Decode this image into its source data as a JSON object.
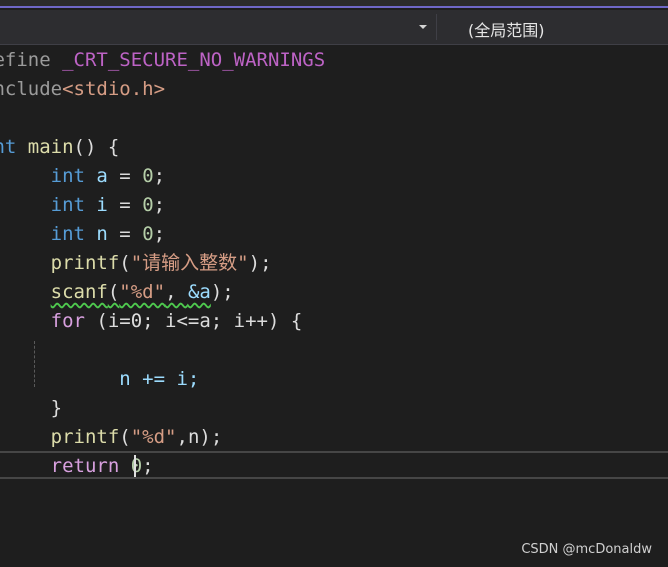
{
  "navigation": {
    "left_dropdown_value": "",
    "scope_label": "(全局范围)"
  },
  "code": {
    "l1_kw": "define",
    "l1_rest": " _CRT_SECURE_NO_WARNINGS",
    "l2_kw": "include",
    "l2_rest": "<stdio.h>",
    "l4_kw": "int",
    "l4_fn": " main",
    "l4_rest": "() {",
    "l5_kw": "int",
    "l5_var": " a",
    "l5_op": " = ",
    "l5_num": "0",
    "l5_end": ";",
    "l6_kw": "int",
    "l6_var": " i",
    "l6_op": " = ",
    "l6_num": "0",
    "l6_end": ";",
    "l7_kw": "int",
    "l7_var": " n",
    "l7_op": " = ",
    "l7_num": "0",
    "l7_end": ";",
    "l8_fn": "printf",
    "l8_open": "(",
    "l8_str": "\"请输入整数\"",
    "l8_close": ");",
    "l9_fn": "scanf",
    "l9_open": "(",
    "l9_str": "\"%d\"",
    "l9_comma": ", ",
    "l9_arg": "&a",
    "l9_close": ");",
    "l10_kw": "for",
    "l10_rest": " (i=0; i<=a; i++) {",
    "l12_text": "n += i;",
    "l13_text": "}",
    "l14_fn": "printf",
    "l14_open": "(",
    "l14_str": "\"%d\"",
    "l14_rest": ",n);",
    "l15_kw": "return",
    "l15_num": " 0",
    "l15_end": ";"
  },
  "watermark": "CSDN @mcDonaldw"
}
